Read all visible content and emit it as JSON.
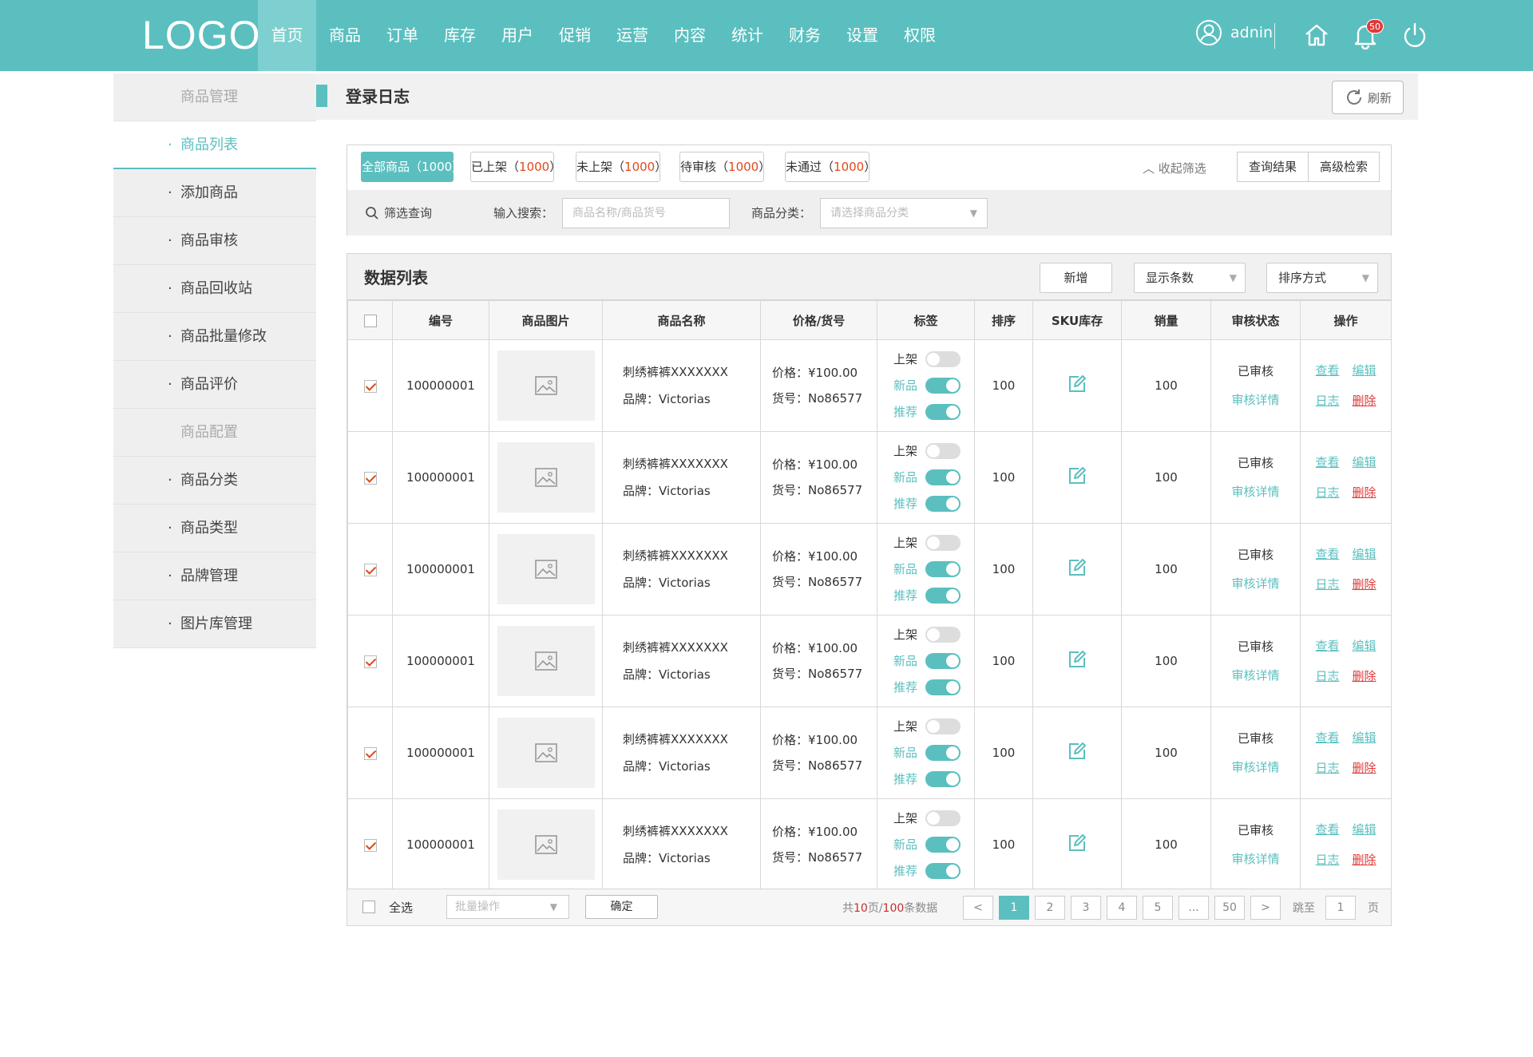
{
  "header": {
    "logo": "LOGO",
    "nav": [
      "首页",
      "商品",
      "订单",
      "库存",
      "用户",
      "促销",
      "运营",
      "内容",
      "统计",
      "财务",
      "设置",
      "权限"
    ],
    "username": "adnin",
    "notif_count": "50"
  },
  "sidebar": {
    "items": [
      {
        "label": "商品管理",
        "type": "group"
      },
      {
        "label": "商品列表",
        "type": "selected"
      },
      {
        "label": "添加商品",
        "type": "item"
      },
      {
        "label": "商品审核",
        "type": "item"
      },
      {
        "label": "商品回收站",
        "type": "item"
      },
      {
        "label": "商品批量修改",
        "type": "item"
      },
      {
        "label": "商品评价",
        "type": "item"
      },
      {
        "label": "商品配置",
        "type": "group"
      },
      {
        "label": "商品分类",
        "type": "item"
      },
      {
        "label": "商品类型",
        "type": "item"
      },
      {
        "label": "品牌管理",
        "type": "item"
      },
      {
        "label": "图片库管理",
        "type": "item"
      }
    ],
    "bullet": "·"
  },
  "titlebar": {
    "title": "登录日志",
    "refresh": "刷新"
  },
  "filter": {
    "tabs": [
      {
        "label": "全部商品",
        "count": "1000",
        "active": true
      },
      {
        "label": "已上架",
        "count": "1000"
      },
      {
        "label": "未上架",
        "count": "1000"
      },
      {
        "label": "待审核",
        "count": "1000"
      },
      {
        "label": "未通过",
        "count": "1000"
      }
    ],
    "lp": "（",
    "rp": "）",
    "collapse": "收起筛选",
    "query_result": "查询结果",
    "advanced": "高级检索",
    "filter_query": "筛选查询",
    "search_label": "输入搜索：",
    "search_placeholder": "商品名称/商品货号",
    "category_label": "商品分类：",
    "category_placeholder": "请选择商品分类"
  },
  "datalist": {
    "title": "数据列表",
    "add": "新增",
    "show_count": "显示条数",
    "sort": "排序方式",
    "columns": [
      "编号",
      "商品图片",
      "商品名称",
      "价格/货号",
      "标签",
      "排序",
      "SKU库存",
      "销量",
      "审核状态",
      "操作"
    ],
    "rows": [
      {
        "id": "100000001",
        "name": "刺绣裤裤XXXXXXX",
        "brand": "品牌：Victorias",
        "price": "价格：¥100.00",
        "sku": "货号：No86577",
        "tag_labels": [
          "上架",
          "新品",
          "推荐"
        ],
        "tag_states": [
          false,
          true,
          true
        ],
        "order": "100",
        "sales": "100",
        "status": "已审核",
        "detail": "审核详情",
        "checked": true
      },
      {
        "id": "100000001",
        "name": "刺绣裤裤XXXXXXX",
        "brand": "品牌：Victorias",
        "price": "价格：¥100.00",
        "sku": "货号：No86577",
        "tag_labels": [
          "上架",
          "新品",
          "推荐"
        ],
        "tag_states": [
          false,
          true,
          true
        ],
        "order": "100",
        "sales": "100",
        "status": "已审核",
        "detail": "审核详情",
        "checked": true
      },
      {
        "id": "100000001",
        "name": "刺绣裤裤XXXXXXX",
        "brand": "品牌：Victorias",
        "price": "价格：¥100.00",
        "sku": "货号：No86577",
        "tag_labels": [
          "上架",
          "新品",
          "推荐"
        ],
        "tag_states": [
          false,
          true,
          true
        ],
        "order": "100",
        "sales": "100",
        "status": "已审核",
        "detail": "审核详情",
        "checked": true
      },
      {
        "id": "100000001",
        "name": "刺绣裤裤XXXXXXX",
        "brand": "品牌：Victorias",
        "price": "价格：¥100.00",
        "sku": "货号：No86577",
        "tag_labels": [
          "上架",
          "新品",
          "推荐"
        ],
        "tag_states": [
          false,
          true,
          true
        ],
        "order": "100",
        "sales": "100",
        "status": "已审核",
        "detail": "审核详情",
        "checked": true
      },
      {
        "id": "100000001",
        "name": "刺绣裤裤XXXXXXX",
        "brand": "品牌：Victorias",
        "price": "价格：¥100.00",
        "sku": "货号：No86577",
        "tag_labels": [
          "上架",
          "新品",
          "推荐"
        ],
        "tag_states": [
          false,
          true,
          true
        ],
        "order": "100",
        "sales": "100",
        "status": "已审核",
        "detail": "审核详情",
        "checked": true
      },
      {
        "id": "100000001",
        "name": "刺绣裤裤XXXXXXX",
        "brand": "品牌：Victorias",
        "price": "价格：¥100.00",
        "sku": "货号：No86577",
        "tag_labels": [
          "上架",
          "新品",
          "推荐"
        ],
        "tag_states": [
          false,
          true,
          true
        ],
        "order": "100",
        "sales": "100",
        "status": "已审核",
        "detail": "审核详情",
        "checked": true
      }
    ],
    "ops": {
      "view": "查看",
      "edit": "编辑",
      "log": "日志",
      "delete": "删除"
    }
  },
  "footer": {
    "select_all": "全选",
    "batch_placeholder": "批量操作",
    "confirm": "确定",
    "summary_prefix": "共",
    "pages_total": "10",
    "summary_mid": "页/",
    "records_total": "100",
    "summary_suffix": "条数据",
    "pages": [
      "<",
      "1",
      "2",
      "3",
      "4",
      "5",
      "...",
      "50",
      ">"
    ],
    "current_page": "1",
    "jump_label": "跳至",
    "jump_value": "1",
    "jump_unit": "页"
  },
  "colors": {
    "accent": "#5bbfbf",
    "danger": "#e03a3a",
    "count": "#e0491b"
  },
  "icons": [
    "user-icon",
    "home-icon",
    "bell-icon",
    "power-icon",
    "refresh-icon",
    "search-icon",
    "chevron-up-icon",
    "image-placeholder-icon",
    "edit-icon",
    "dropdown-arrow-icon"
  ]
}
